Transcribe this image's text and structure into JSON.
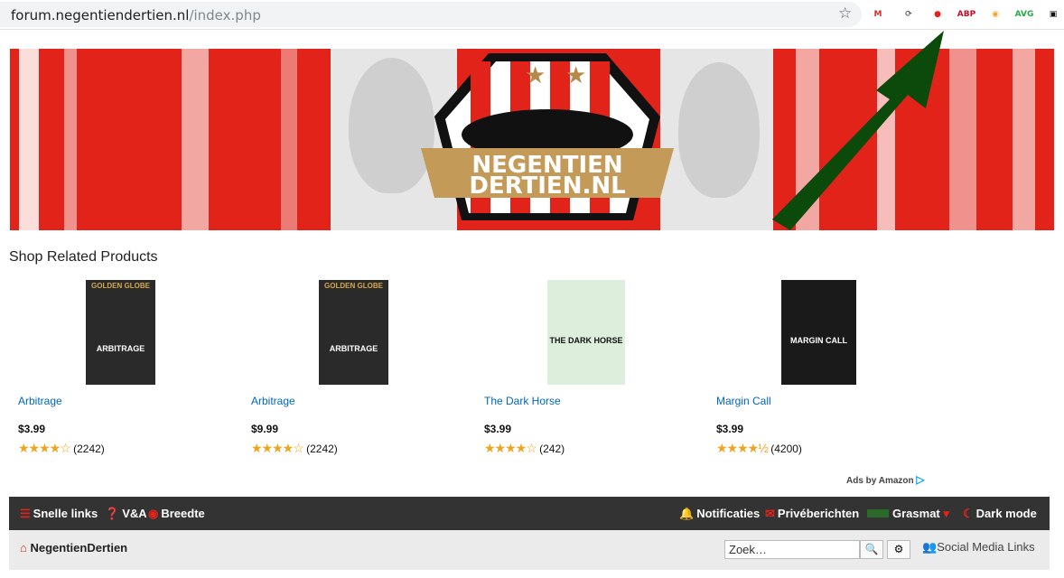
{
  "browser": {
    "url_host": "forum.negentiendertien.nl",
    "url_path": "/index.php",
    "extensions": [
      {
        "name": "gmail-icon",
        "label": "M",
        "color": "#d93025"
      },
      {
        "name": "reload-icon",
        "label": "⟳",
        "color": "#5f6368"
      },
      {
        "name": "ublock-icon",
        "label": "●",
        "color": "#e8201a"
      },
      {
        "name": "adblock-plus-icon",
        "label": "ABP",
        "color": "#c70d2c"
      },
      {
        "name": "owl-extension-icon",
        "label": "◉",
        "color": "#f0a42b"
      },
      {
        "name": "avg-icon",
        "label": "AVG",
        "color": "#2aa845"
      },
      {
        "name": "dark-extension-icon",
        "label": "▣",
        "color": "#111111"
      }
    ]
  },
  "banner": {
    "logo_line1": "NEGENTIEN",
    "logo_line2": "DERTIEN.NL"
  },
  "shop": {
    "title": "Shop Related Products",
    "products": [
      {
        "title": "Arbitrage",
        "price": "$3.99",
        "stars": "★★★★☆",
        "reviews": "(2242)",
        "cover_caption": "ARBITRAGE",
        "cover_top": "GOLDEN GLOBE"
      },
      {
        "title": "Arbitrage",
        "price": "$9.99",
        "stars": "★★★★☆",
        "reviews": "(2242)",
        "cover_caption": "ARBITRAGE",
        "cover_top": "GOLDEN GLOBE"
      },
      {
        "title": "The Dark Horse",
        "price": "$3.99",
        "stars": "★★★★☆",
        "reviews": "(242)",
        "cover_caption": "THE DARK HORSE",
        "cover_top": ""
      },
      {
        "title": "Margin Call",
        "price": "$3.99",
        "stars": "★★★★½",
        "reviews": "(4200)",
        "cover_caption": "MARGIN CALL",
        "cover_top": ""
      }
    ],
    "ads_label": "Ads by Amazon"
  },
  "nav": {
    "quick_links": "Snelle links",
    "faq": "V&A",
    "width": "Breedte",
    "notifications": "Notificaties",
    "private_messages": "Privéberichten",
    "user": "Grasmat",
    "dark_mode": "Dark mode"
  },
  "subbar": {
    "breadcrumb": "NegentienDertien",
    "search_placeholder": "Zoek…",
    "social": "Social Media Links"
  },
  "colors": {
    "accent": "#e2231a",
    "nav_bg": "#333333",
    "link": "#0066c0"
  }
}
